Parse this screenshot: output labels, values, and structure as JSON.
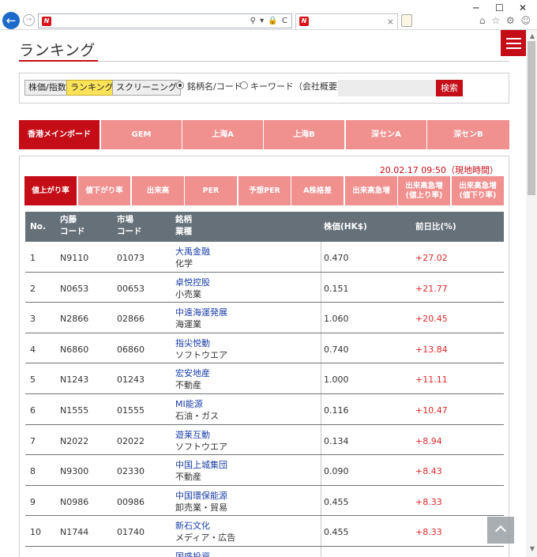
{
  "browser": {
    "back_icon": "←",
    "forward_icon": "→",
    "address_icons": "⚲ ▾ 🔒 C",
    "tab_close": "×",
    "window_controls": [
      "─",
      "☐",
      "✕"
    ],
    "toolbar_icons": "⌂ ☆ ⚙ ☺",
    "favicon_letter": "N"
  },
  "page": {
    "title": "ランキング"
  },
  "nav": {
    "stock_index": "株価/指数",
    "ranking": "ランキング",
    "screening": "スクリーニング",
    "radio_name_code": "銘柄名/コード",
    "radio_keyword": "キーワード（会社概要）",
    "search_placeholder": "",
    "search_button": "検索"
  },
  "market_tabs": [
    "香港メインボード",
    "GEM",
    "上海A",
    "上海B",
    "深センA",
    "深センB"
  ],
  "timestamp": "20.02.17 09:50（現地時間）",
  "rank_tabs": [
    "値上がり率",
    "値下がり率",
    "出来高",
    "PER",
    "予想PER",
    "A株格差",
    "出来高急増",
    "出来高急増\n(値上り率)",
    "出来高急増\n(値下り率)"
  ],
  "table": {
    "headers": {
      "no": "No.",
      "naito": "内藤",
      "naito2": "コード",
      "market": "市場",
      "market2": "コード",
      "stock": "銘柄",
      "stock2": "業種",
      "price": "株価(HK$)",
      "change": "前日比(%)"
    },
    "rows": [
      {
        "no": "1",
        "naito": "N9110",
        "code": "01073",
        "name": "大禹金融",
        "industry": "化学",
        "price": "0.470",
        "change": "+27.02"
      },
      {
        "no": "2",
        "naito": "N0653",
        "code": "00653",
        "name": "卓悦控股",
        "industry": "小売業",
        "price": "0.151",
        "change": "+21.77"
      },
      {
        "no": "3",
        "naito": "N2866",
        "code": "02866",
        "name": "中遠海運発展",
        "industry": "海運業",
        "price": "1.060",
        "change": "+20.45"
      },
      {
        "no": "4",
        "naito": "N6860",
        "code": "06860",
        "name": "指尖悦動",
        "industry": "ソフトウエア",
        "price": "0.740",
        "change": "+13.84"
      },
      {
        "no": "5",
        "naito": "N1243",
        "code": "01243",
        "name": "宏安地産",
        "industry": "不動産",
        "price": "1.000",
        "change": "+11.11"
      },
      {
        "no": "6",
        "naito": "N1555",
        "code": "01555",
        "name": "MI能源",
        "industry": "石油・ガス",
        "price": "0.116",
        "change": "+10.47"
      },
      {
        "no": "7",
        "naito": "N2022",
        "code": "02022",
        "name": "遊莱互動",
        "industry": "ソフトウエア",
        "price": "0.134",
        "change": "+8.94"
      },
      {
        "no": "8",
        "naito": "N9300",
        "code": "02330",
        "name": "中国上城集団",
        "industry": "不動産",
        "price": "0.090",
        "change": "+8.43"
      },
      {
        "no": "9",
        "naito": "N0986",
        "code": "00986",
        "name": "中国環保能源",
        "industry": "卸売業・貿易",
        "price": "0.455",
        "change": "+8.33"
      },
      {
        "no": "10",
        "naito": "N1744",
        "code": "01740",
        "name": "新石文化",
        "industry": "メディア・広告",
        "price": "0.455",
        "change": "+8.33"
      },
      {
        "no": "",
        "naito": "",
        "code": "",
        "name": "国盛投資",
        "industry": "",
        "price": "",
        "change": ""
      }
    ]
  },
  "colors": {
    "brand_red": "#c40d17",
    "tab_pink": "#f0908f",
    "header_gray": "#667079",
    "highlight_yellow": "#fce35a"
  }
}
